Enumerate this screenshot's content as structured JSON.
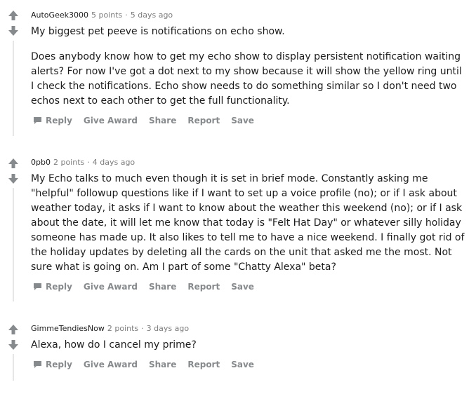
{
  "actions": {
    "reply": "Reply",
    "give_award": "Give Award",
    "share": "Share",
    "report": "Report",
    "save": "Save"
  },
  "comments": [
    {
      "author": "AutoGeek3000",
      "points": "5 points",
      "dot": "·",
      "time": "5 days ago",
      "paragraphs": [
        "My biggest pet peeve is notifications on echo show.",
        "Does anybody know how to get my echo show to display persistent notification waiting alerts? For now I've got a dot next to my show because it will show the yellow ring until I check the notifications. Echo show needs to do something similar so I don't need two echos next to each other to get the full functionality."
      ]
    },
    {
      "author": "0pb0",
      "points": "2 points",
      "dot": "·",
      "time": "4 days ago",
      "paragraphs": [
        "My Echo talks to much even though it is set in brief mode. Constantly asking me \"helpful\" followup questions like if I want to set up a voice profile (no); or if I ask about weather today, it asks if I want to know about the weather this weekend (no); or if I ask about the date, it will let me know that today is \"Felt Hat Day\" or whatever silly holiday someone has made up. It also likes to tell me to have a nice weekend. I finally got rid of the holiday updates by deleting all the cards on the unit that asked me the most. Not sure what is going on. Am I part of some \"Chatty Alexa\" beta?"
      ]
    },
    {
      "author": "GimmeTendiesNow",
      "points": "2 points",
      "dot": "·",
      "time": "3 days ago",
      "paragraphs": [
        "Alexa, how do I cancel my prime?"
      ]
    }
  ]
}
